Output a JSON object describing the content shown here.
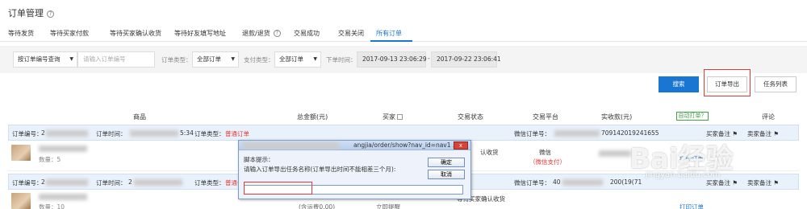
{
  "page": {
    "title": "订单管理"
  },
  "tabs": [
    {
      "label": "等待发货"
    },
    {
      "label": "等待买家付款"
    },
    {
      "label": "等待买家确认收货"
    },
    {
      "label": "等待好友填写地址"
    },
    {
      "label": "退款/退货"
    },
    {
      "label": "交易成功"
    },
    {
      "label": "交易关闭"
    },
    {
      "label": "所有订单",
      "active": true
    }
  ],
  "filters": {
    "search_type": "按订单编号查询",
    "order_no_placeholder": "请输入订单编号",
    "order_type_label": "订单类型：",
    "order_type_value": "全部订单",
    "pay_type_label": "支付类型：",
    "pay_type_value": "全部订单",
    "order_time_label": "下单时间：",
    "date_from": "2017-09-13 23:06:29",
    "date_to": "2017-09-22 23:06:41"
  },
  "actions": {
    "search": "搜索",
    "export": "订单导出",
    "task_list": "任务列表"
  },
  "table_headers": {
    "product": "商品",
    "total": "总金额(元)",
    "buyer": "买家",
    "status": "交易状态",
    "platform": "交易平台",
    "paid": "实收款(元)",
    "auto_print": "自动打单？",
    "comment": "评论"
  },
  "orders": [
    {
      "order_no_label": "订单编号：",
      "order_no_prefix": "2",
      "time_label": "订单时间：",
      "time_suffix": "5:34",
      "type_label": "订单类型：",
      "type_value": "普通订单",
      "wechat_no_label": "微信订单号：",
      "wechat_no_suffix": "709142019241655",
      "buyer_note": "买家备注",
      "seller_note": "卖家备注",
      "qty": "数量：5",
      "status": "认收货",
      "platform": "微信",
      "pay": "（微信支付）",
      "print": "打印订单"
    },
    {
      "order_no_label": "订单编号：",
      "order_no_prefix": "2",
      "time_label": "订单时间：",
      "time_prefix": "2",
      "type_label": "订单类型：",
      "type_value": "普通订单",
      "wechat_no_label": "微信订单号：",
      "wechat_no_prefix": "40",
      "wechat_no_suffix": "200(19(71",
      "buyer_note": "买家备注",
      "seller_note": "卖家备注",
      "qty": "数量：10",
      "freight": "(含运费0.00)",
      "status": "等待买家确认收货",
      "status2": "立即提醒",
      "print": "打印订单"
    }
  ],
  "dialog": {
    "title": "angjia/order/show?nav_id=nav1 ...",
    "close": "x",
    "heading": "脚本提示：",
    "prompt": "请输入订单导出任务名称(订单导出时间不能相差三个月):",
    "ok": "确定",
    "cancel": "取消",
    "value": ""
  },
  "watermark": {
    "brand": "Bai经验",
    "url": "jingyan.baidu.com"
  }
}
